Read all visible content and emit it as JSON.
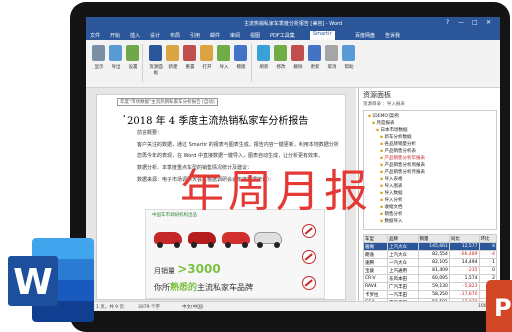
{
  "window": {
    "title": "主流热销私家车季度分析报告 [兼容] - Word",
    "controls": [
      "?",
      "—",
      "□",
      "✕"
    ]
  },
  "ribbon_tabs": [
    "文件",
    "开始",
    "插入",
    "设计",
    "布局",
    "引用",
    "邮件",
    "审阅",
    "视图",
    "PDF工具集",
    "Smartir",
    "百度网盘",
    "告诉我"
  ],
  "active_tab_index": 10,
  "ribbon_buttons": [
    "显示",
    "导出",
    "设置",
    "资源面板",
    "新建",
    "重置",
    "打开",
    "导入",
    "模版",
    "刷新",
    "修改",
    "删除",
    "更新",
    "取消",
    "帮助"
  ],
  "doc": {
    "header_text": "年度\"市场数据\"主流热销私家车分析报告 [自动]",
    "title": "2018 年 4 季度主流热销私家车分析报告",
    "paragraphs": [
      "前言概要：",
      "      客户关注的数据，通过 Smartir 的报表与图表生成，报告内容一键更新，利用本地数据分析",
      "      您再今年的表现，在 Word 中直接数据一键导入，图表自动生成，让分析更有效率。",
      "      数据分析、本季度重点车型的销售情况统计及建议：",
      "      数据来源：电子市场调研大会（根据调研会会年度数据统计）："
    ],
    "ad": {
      "brand": "中国车市调研机构出品",
      "sales_label": "月销量",
      "sales_value": ">3000",
      "line2_pre": "你所",
      "line2_highlight": "熟悉的",
      "line2_post": "主流私家车品牌"
    }
  },
  "overlay_text": "年周月报",
  "side_panel": {
    "title": "资源面板",
    "subtitle": "资源目录 ：导入报表",
    "tree": [
      {
        "label": "[DEMO]案例",
        "red": false
      },
      {
        "label": "月度报表",
        "red": false
      },
      {
        "label": "日本市场数据",
        "red": false
      },
      {
        "label": "新车分析数据",
        "red": false
      },
      {
        "label": "各品牌销量分析",
        "red": false
      },
      {
        "label": "产品销售分析表",
        "red": false
      },
      {
        "label": "产品销售分析年报表",
        "red": true
      },
      {
        "label": "产品销售分析周报表",
        "red": false
      },
      {
        "label": "产品销售分析月报表",
        "red": false
      },
      {
        "label": "导入表格",
        "red": false
      },
      {
        "label": "导入图表",
        "red": false
      },
      {
        "label": "导入数据",
        "red": false
      },
      {
        "label": "导入分析",
        "red": false
      },
      {
        "label": "收缩文档",
        "red": false
      },
      {
        "label": "销售分析",
        "red": false
      },
      {
        "label": "数据导入",
        "red": false
      }
    ],
    "table_header": [
      "车型",
      "品牌",
      "销量",
      "同比",
      "环比"
    ],
    "table": [
      [
        "雅阁",
        "上汽大众",
        "145,661",
        "12,577",
        "8"
      ],
      [
        "朗逸",
        "上汽大众",
        "82,554",
        "-66,489",
        "-4"
      ],
      [
        "速腾",
        "一汽大众",
        "82,105",
        "14,494",
        "1"
      ],
      [
        "宝骏",
        "上汽通用",
        "81,409",
        "-235",
        "0"
      ],
      [
        "CR-V",
        "东风本田",
        "60,095",
        "1,574",
        "2"
      ],
      [
        "RAV4",
        "广汽丰田",
        "59,130",
        "-5,823",
        "-1"
      ],
      [
        "卡罗拉",
        "一汽丰田",
        "58,250",
        "-17,870",
        "-2"
      ],
      [
        "GS4",
        "广汽传祺",
        "56,501",
        "-17,870",
        "-2"
      ],
      [
        "XR-V",
        "东风本田",
        "55,150",
        "12,000",
        "2"
      ],
      [
        "ix35",
        "北京现代",
        "55,000",
        "6,000",
        "1"
      ]
    ]
  },
  "statusbar": {
    "page": "第 1 页，共 9 页",
    "words": "3079 个字",
    "lang": "中文(中国)",
    "zoom": "100%"
  },
  "colors": {
    "word_blue": "#2b579a",
    "overlay_red": "#e53935",
    "accent_green": "#7cc242",
    "ppt_orange": "#d24726"
  }
}
